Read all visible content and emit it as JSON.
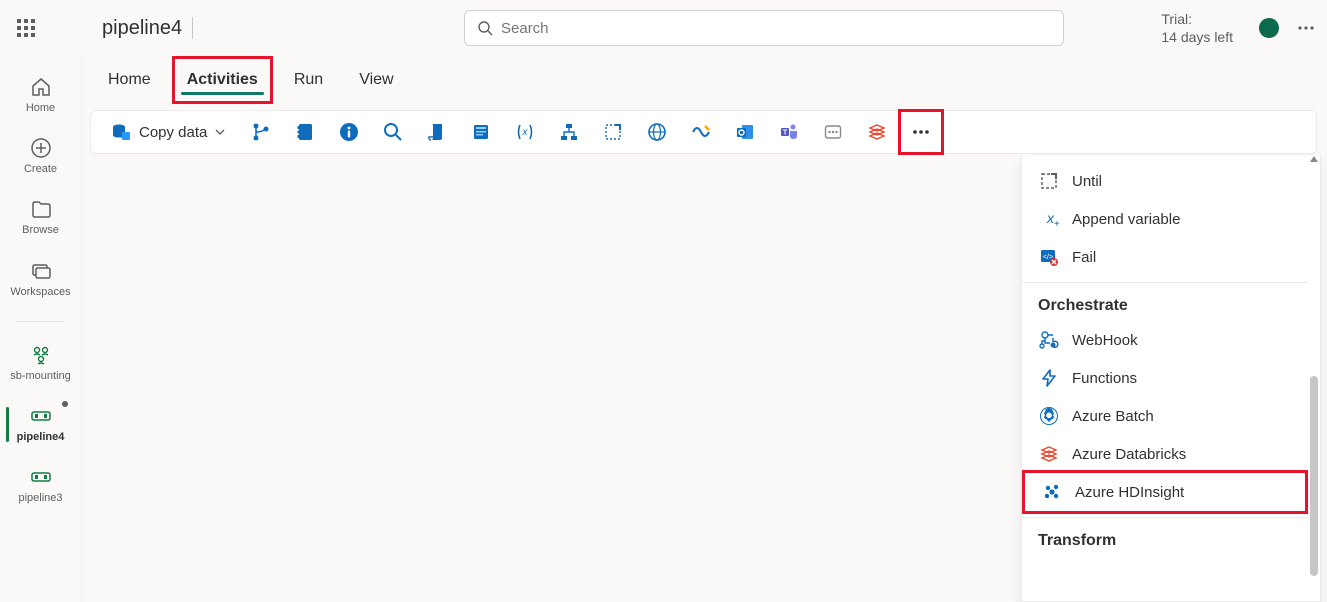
{
  "header": {
    "title": "pipeline4",
    "search_placeholder": "Search",
    "trial_line1": "Trial:",
    "trial_line2": "14 days left"
  },
  "rail": {
    "items": [
      {
        "id": "home",
        "label": "Home"
      },
      {
        "id": "create",
        "label": "Create"
      },
      {
        "id": "browse",
        "label": "Browse"
      },
      {
        "id": "workspaces",
        "label": "Workspaces"
      },
      {
        "id": "sb-mounting",
        "label": "sb-mounting"
      },
      {
        "id": "pipeline4",
        "label": "pipeline4"
      },
      {
        "id": "pipeline3",
        "label": "pipeline3"
      }
    ]
  },
  "tabs": {
    "items": [
      {
        "id": "home",
        "label": "Home"
      },
      {
        "id": "activities",
        "label": "Activities"
      },
      {
        "id": "run",
        "label": "Run"
      },
      {
        "id": "view",
        "label": "View"
      }
    ],
    "active": "activities",
    "highlighted": "activities"
  },
  "toolbar": {
    "primary_label": "Copy data",
    "buttons": [
      "branch-icon",
      "notebook-icon",
      "info-icon",
      "magnifier-icon",
      "script-icon",
      "page-icon",
      "variable-icon",
      "dataflow-icon",
      "blueprint-icon",
      "globe-icon",
      "dataverse-icon",
      "outlook-icon",
      "teams-icon",
      "card-icon",
      "databricks-icon"
    ],
    "more_label": "More"
  },
  "dropdown": {
    "sections": [
      {
        "header": null,
        "items": [
          {
            "id": "until",
            "label": "Until"
          },
          {
            "id": "append-variable",
            "label": "Append variable"
          },
          {
            "id": "fail",
            "label": "Fail"
          }
        ]
      },
      {
        "header": "Orchestrate",
        "items": [
          {
            "id": "webhook",
            "label": "WebHook"
          },
          {
            "id": "functions",
            "label": "Functions"
          },
          {
            "id": "azure-batch",
            "label": "Azure Batch"
          },
          {
            "id": "azure-databricks",
            "label": "Azure Databricks"
          },
          {
            "id": "azure-hdinsight",
            "label": "Azure HDInsight"
          }
        ]
      },
      {
        "header": "Transform",
        "items": []
      }
    ],
    "highlighted": "azure-hdinsight"
  }
}
